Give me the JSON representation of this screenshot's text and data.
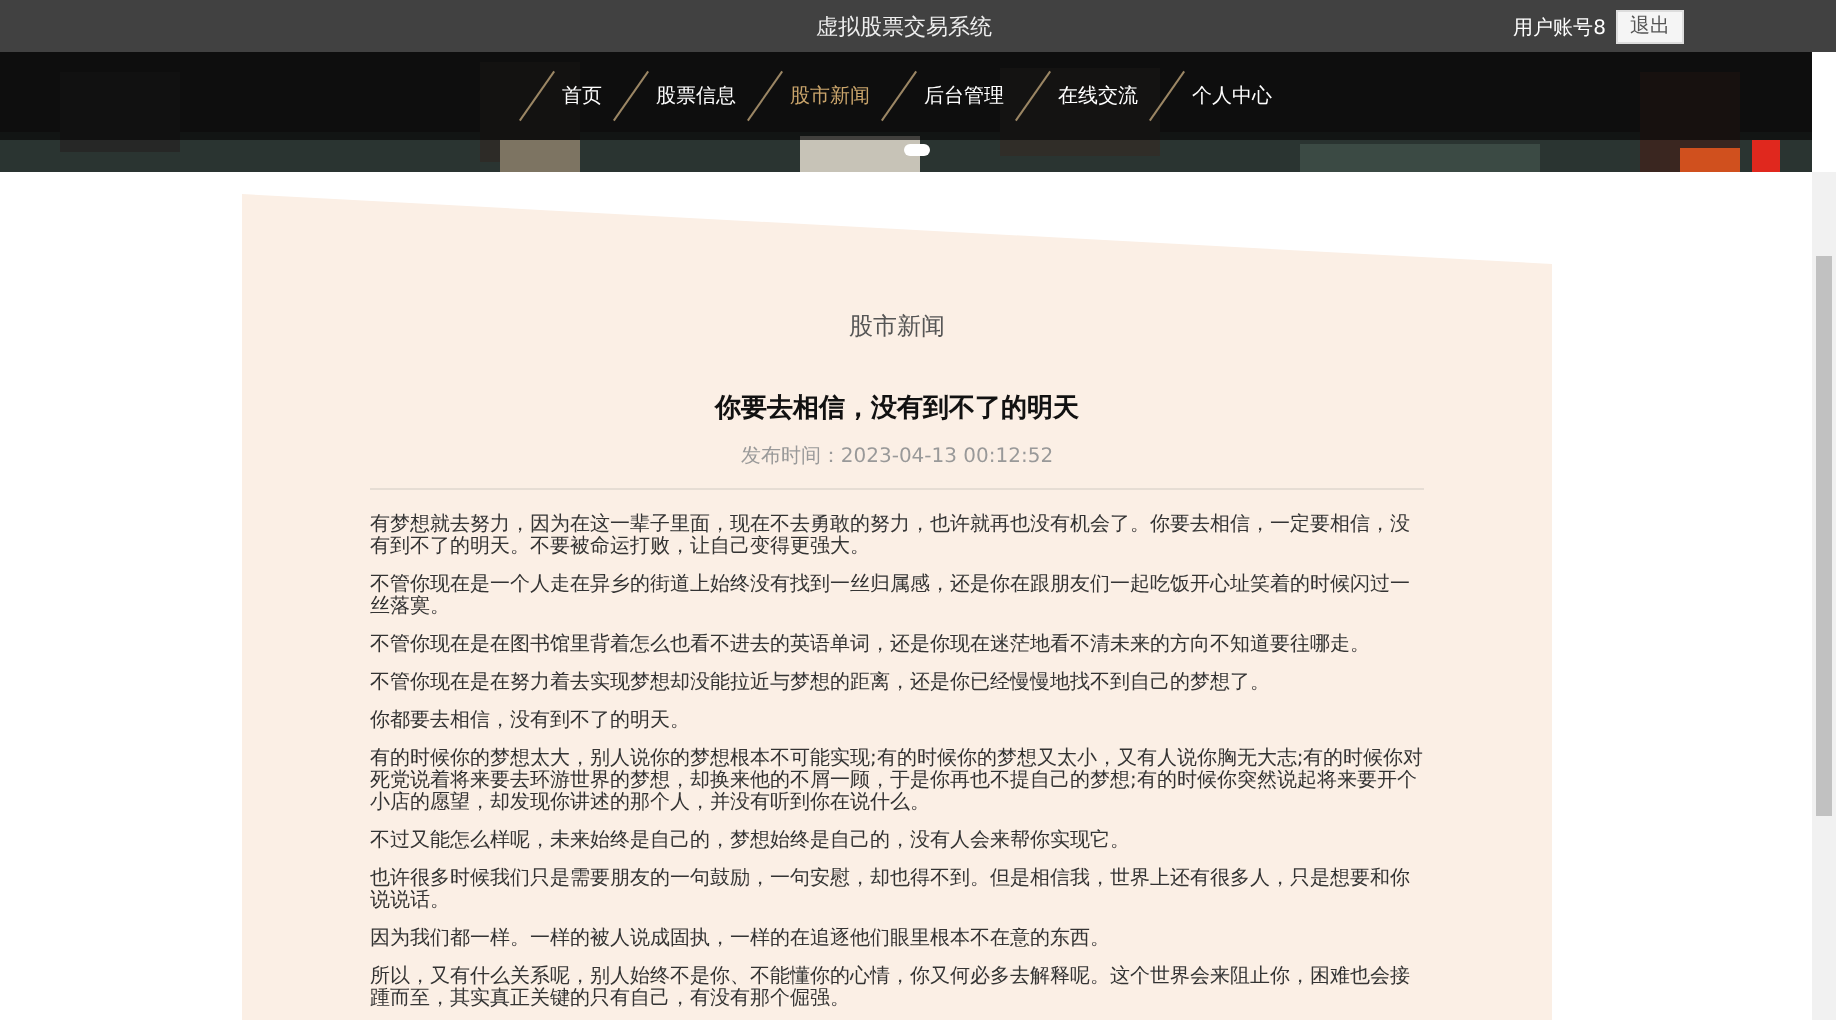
{
  "header": {
    "title": "虚拟股票交易系统",
    "user": "用户账号8",
    "logout_button": "退出"
  },
  "nav": [
    {
      "label": "首页",
      "selected": false
    },
    {
      "label": "股票信息",
      "selected": false
    },
    {
      "label": "股市新闻",
      "selected": true
    },
    {
      "label": "后台管理",
      "selected": false
    },
    {
      "label": "在线交流",
      "selected": false
    },
    {
      "label": "个人中心",
      "selected": false
    }
  ],
  "article": {
    "section_title": "股市新闻",
    "title": "你要去相信，没有到不了的明天",
    "publish_time": "发布时间：2023-04-13 00:12:52",
    "paragraphs": [
      "有梦想就去努力，因为在这一辈子里面，现在不去勇敢的努力，也许就再也没有机会了。你要去相信，一定要相信，没有到不了的明天。不要被命运打败，让自己变得更强大。",
      "不管你现在是一个人走在异乡的街道上始终没有找到一丝归属感，还是你在跟朋友们一起吃饭开心址笑着的时候闪过一丝落寞。",
      "不管你现在是在图书馆里背着怎么也看不进去的英语单词，还是你现在迷茫地看不清未来的方向不知道要往哪走。",
      "不管你现在是在努力着去实现梦想却没能拉近与梦想的距离，还是你已经慢慢地找不到自己的梦想了。",
      "你都要去相信，没有到不了的明天。",
      "有的时候你的梦想太大，别人说你的梦想根本不可能实现;有的时候你的梦想又太小，又有人说你胸无大志;有的时候你对死党说着将来要去环游世界的梦想，却换来他的不屑一顾，于是你再也不提自己的梦想;有的时候你突然说起将来要开个小店的愿望，却发现你讲述的那个人，并没有听到你在说什么。",
      "不过又能怎么样呢，未来始终是自己的，梦想始终是自己的，没有人会来帮你实现它。",
      "也许很多时候我们只是需要朋友的一句鼓励，一句安慰，却也得不到。但是相信我，世界上还有很多人，只是想要和你说说话。",
      "因为我们都一样。一样的被人说成固执，一样的在追逐他们眼里根本不在意的东西。",
      "所以，又有什么关系呢，别人始终不是你、不能懂你的心情，你又何必多去解释呢。这个世界会来阻止你，困难也会接踵而至，其实真正关键的只有自己，有没有那个倔强。"
    ]
  }
}
